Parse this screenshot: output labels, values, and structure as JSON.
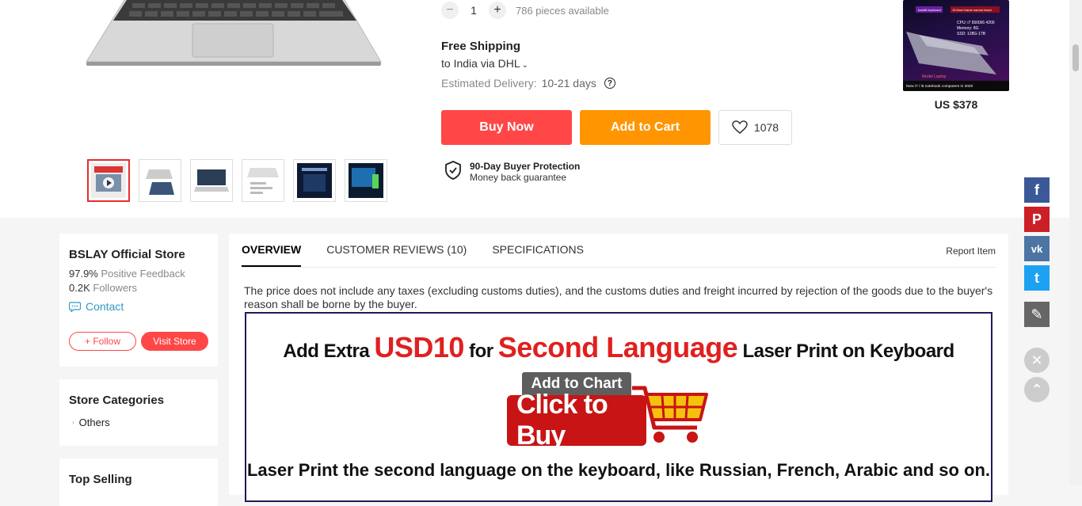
{
  "purchase": {
    "quantity": "1",
    "minus": "−",
    "plus": "+",
    "available": "786 pieces available"
  },
  "shipping": {
    "title": "Free Shipping",
    "destination": "to India via DHL",
    "caret": "⌄",
    "estimated_label": "Estimated Delivery:",
    "estimated_value": "10-21 days",
    "help_glyph": "?"
  },
  "actions": {
    "buy_now": "Buy Now",
    "add_to_cart": "Add to Cart",
    "wishlist_count": "1078"
  },
  "protection": {
    "title": "90-Day Buyer Protection",
    "subtitle": "Money back guarantee"
  },
  "recommendation": {
    "price": "US $378",
    "image_text": {
      "tag1": "backlit keyboard",
      "tag2": "15.6mm frame narrow bezel",
      "cpu": "CPU: i7 5500/i5 4200",
      "memory": "Memory: 8G",
      "ssd": "SSD: 128G-1TB",
      "model": "Model Laptop",
      "footer": "New i7 / i5 notebook computers in 2020"
    }
  },
  "social": {
    "facebook": "f",
    "pinterest": "P",
    "vk": "vk",
    "twitter": "t",
    "edit": "✎",
    "close": "✕",
    "top": "⌃"
  },
  "store": {
    "name": "BSLAY Official Store",
    "feedback_value": "97.9%",
    "feedback_label": "Positive Feedback",
    "followers_value": "0.2K",
    "followers_label": "Followers",
    "contact": "Contact",
    "follow": "+ Follow",
    "visit": "Visit Store"
  },
  "categories": {
    "title": "Store Categories",
    "items": [
      "Others"
    ],
    "arrow": "›"
  },
  "top_selling": {
    "title": "Top Selling"
  },
  "tabs": {
    "items": [
      "OVERVIEW",
      "CUSTOMER REVIEWS (10)",
      "SPECIFICATIONS"
    ],
    "report": "Report Item"
  },
  "overview": {
    "description": "The price does not include any taxes (excluding customs duties), and the customs duties and freight incurred by rejection of the goods due to the buyer's reason shall be borne by the buyer.",
    "banner": {
      "part1": "Add Extra ",
      "part2": "USD10",
      "part3": " for ",
      "part4": "Second Language",
      "part5": " Laser Print on Keyboard",
      "tag": "Add to Chart",
      "button": "Click to Buy",
      "line3": "Laser Print the second language on the keyboard, like Russian, French, Arabic and so on."
    }
  },
  "colors": {
    "buy": "#ff4747",
    "cart": "#ff9500",
    "accent_red": "#e62e2e",
    "link": "#2e9cc3"
  }
}
